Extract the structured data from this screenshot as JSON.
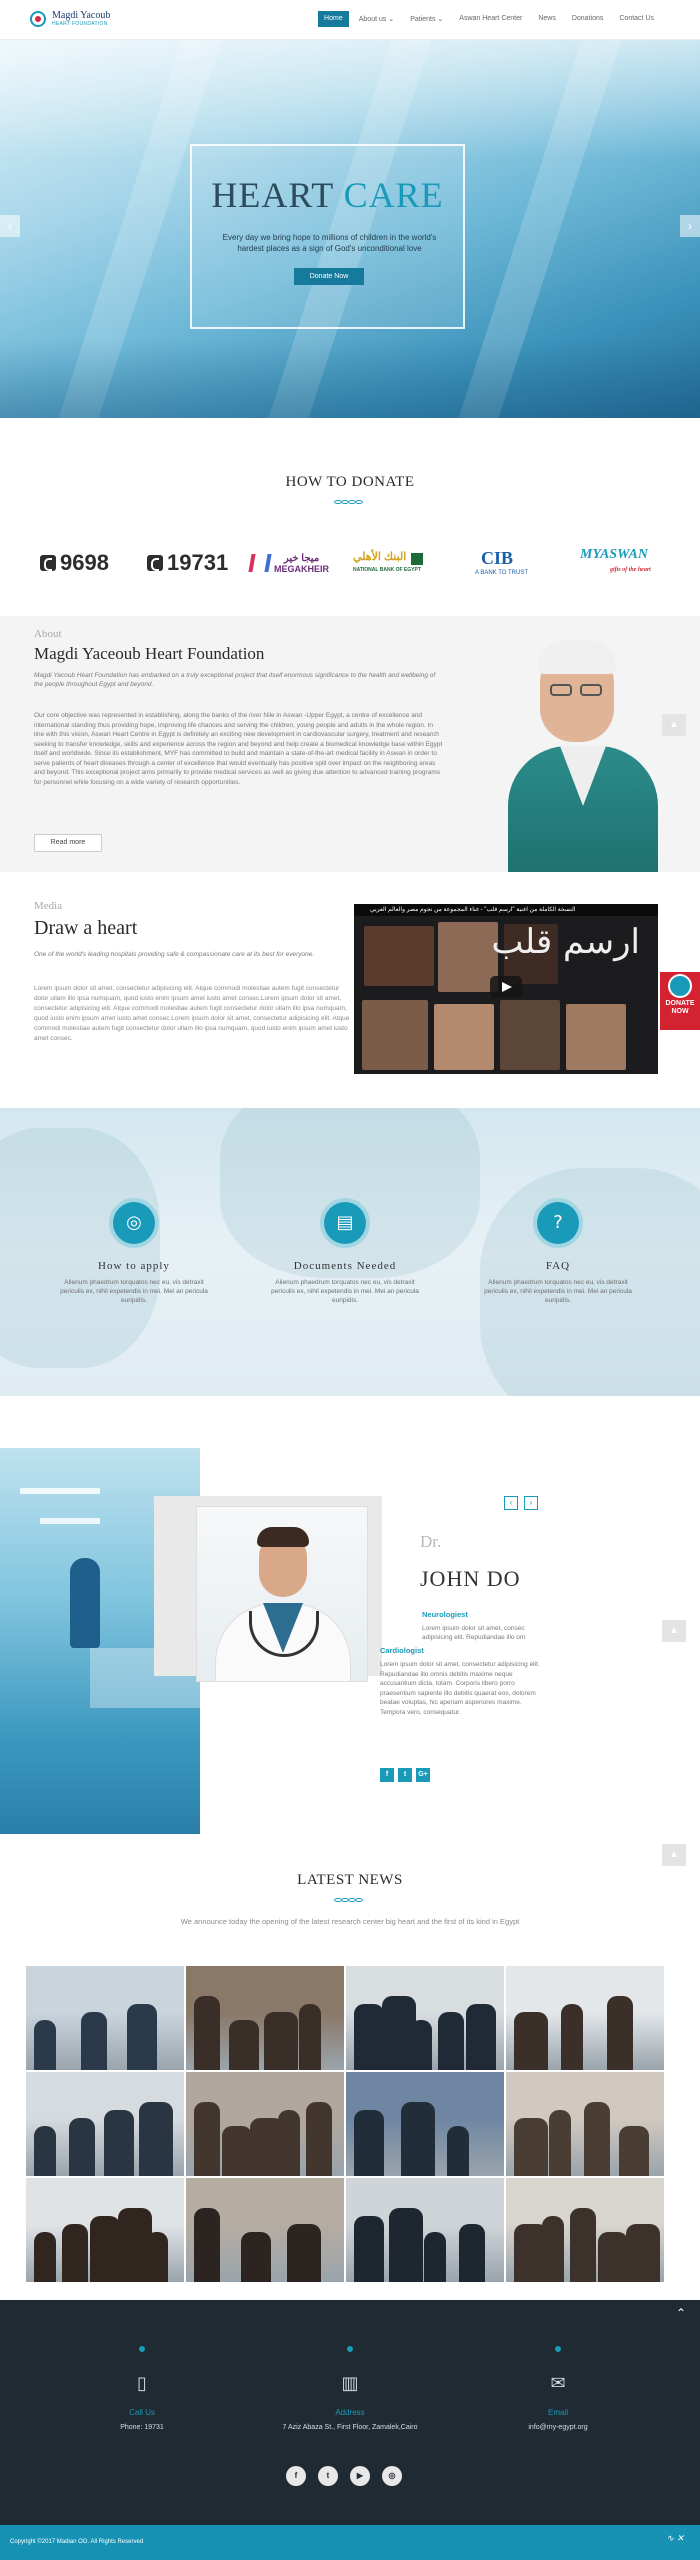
{
  "header": {
    "logo_name": "Magdi Yacoub",
    "logo_sub": "HEART FOUNDATION",
    "nav": [
      {
        "label": "Home",
        "active": true
      },
      {
        "label": "About us ⌄",
        "active": false
      },
      {
        "label": "Patients ⌄",
        "active": false
      },
      {
        "label": "Aswan Heart Center",
        "active": false
      },
      {
        "label": "News",
        "active": false
      },
      {
        "label": "Donations",
        "active": false
      },
      {
        "label": "Contact Us",
        "active": false
      }
    ]
  },
  "hero": {
    "title_word1": "HEART",
    "title_word2": "CARE",
    "subtitle": "Every day we bring hope to millions of children in the world's hardest places as a sign of God's unconditional love",
    "button": "Donate Now",
    "prev_icon": "‹",
    "next_icon": "›"
  },
  "donate": {
    "title": "HOW TO DONATE",
    "phone1": "9698",
    "phone2": "19731",
    "mega_ar": "ميجا خير",
    "mega_en": "MEGAKHEIR",
    "nbe_ar": "البنك الأهلي",
    "nbe_en": "NATIONAL BANK OF EGYPT",
    "cib": "CIB",
    "cib_tag": "A BANK TO TRUST",
    "myaswan": "MYASWAN",
    "myaswan_tag": "gifts of the heart"
  },
  "about": {
    "eyebrow": "About",
    "title": "Magdi Yaceoub Heart Foundation",
    "lead": "Magdi Yacoub Heart Foundation has embarked on a truly exceptional project that itself enormous significance to the health and wellbeing of the people throughout Egypt and beyond.",
    "body": "Our core objective was represented in establishing, along the banks of the river Nile in Aswan -Upper Egypt, a centre of excellence and international standing thus providing hope, improving life chances and serving the children, young people and adults in the whole region. In line with this vision, Aswan Heart Centre in Egypt is definitely an exciting new development in cardiovascular surgery, treatment and research seeking to transfer knowledge, skills and experience across the region and beyond and help create a biomedical knowledge base within Egypt itself and worldwide. Since its establishment, MYF has committed to build and maintain a state-of-the-art medical facility in Aswan in order to serve patients of heart diseases through a center of excellence that would eventually has positive spill over impact on the neighboring areas and beyond. This exceptional project aims primarily to provide medical services as well as giving due attention to advanced training programs for personnel while focusing on a wide variety of research opportunities.",
    "button": "Read more"
  },
  "media": {
    "eyebrow": "Media",
    "title": "Draw a heart",
    "lead": "One of the world's leading hospitals providing safe & compassionate care at its best for everyone.",
    "body": "Lorem ipsum dolor sit amet, consectetur adipisicing elit. Atque commodi molestiae autem fugit consectetur dolor ullam illo ipsa numquam, quod iusto enim ipsum amet iusto amet consec.Lorem ipsum dolor sit amet, consectetur adipisicing elit. Atque commodi molestiae autem fugit consectetur dolor ullam illo ipsa numquam, quod iusto enim ipsum amet iusto amet consec.Lorem ipsum dolor sit amet, consectetur adipisicing elit. Atque commodi molestiae autem fugit consectetur dolor ullam illo ipsa numquam, quod iusto enim ipsum amet iusto amet consec.",
    "video_title": "النسخة الكاملة من اغنية \"ارسم قلب\" - غناء المجموعة من نجوم مصر والعالم العربي",
    "video_overlay": "ارسم قلب"
  },
  "donate_badge": "DONATE NOW",
  "services": [
    {
      "icon": "life-ring",
      "glyph": "◎",
      "title": "How  to  apply",
      "text": "Alienum phaedrum torquatos nec eu, vis detraxit periculis ex, nihil expetendis in mei. Mei an pericula euripidis."
    },
    {
      "icon": "document",
      "glyph": "▤",
      "title": "Documents  Needed",
      "text": "Alienum phaedrum torquatos nec eu, vis detraxit periculis ex, nihil expetendis in mei. Mei an pericula euripidis."
    },
    {
      "icon": "question",
      "glyph": "?",
      "title": "FAQ",
      "text": "Alienum phaedrum torquatos nec eu, vis detraxit periculis ex, nihil expetendis in mei. Mei an pericula euripidis."
    }
  ],
  "doctor": {
    "prefix": "Dr.",
    "name": "JOHN DO",
    "specialty1": "Neurologiest",
    "text1": "Lorem ipsum dolor sit amet, consec adipisicing elit. Repudiandae illo om",
    "specialty2": "Cardiologist",
    "text2": "Lorem ipsum dolor sit amet, consectetur adipisicing elit. Repudiandae illo omnis debitis maxime neque accusantium dicta, totam. Corporis libero porro praesentium sapiente illo debitis quaerat eos, dolorem beatae voluptas, hic aperiam asperiores maxime. Tempora vero, consequatur.",
    "prev": "‹",
    "next": "›",
    "social": [
      "f",
      "t",
      "G+"
    ]
  },
  "news": {
    "title": "LATEST NEWS",
    "subtitle": "We announce today the opening of the latest research center big heart and the first of its kind in Egypt"
  },
  "footer": {
    "back_to_top": "⌃",
    "columns": [
      {
        "icon": "phone",
        "glyph": "▯",
        "label": "Call Us",
        "value": "Phone: 19731"
      },
      {
        "icon": "map",
        "glyph": "▥",
        "label": "Address",
        "value": "7 Aziz Abaza St., First Floor, Zamalek,Cairo"
      },
      {
        "icon": "envelope",
        "glyph": "✉",
        "label": "Email",
        "value": "info@my-egypt.org"
      }
    ],
    "social": [
      "f",
      "t",
      "▶",
      "◎"
    ],
    "copyright": "Copyright ©2017 Madian OO. All Rights Reserved"
  },
  "colors": {
    "accent": "#1a9ab9",
    "nav_active": "#167a9c",
    "footer_bg": "#202a33",
    "copyright_bg": "#1791b4",
    "donate_red": "#d42330"
  }
}
